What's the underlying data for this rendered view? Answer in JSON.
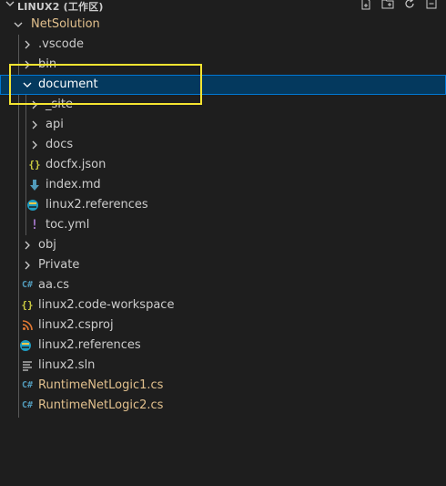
{
  "explorer": {
    "workspace_title": "LINUX2 (工作区)",
    "header_icons": [
      "new-file-icon",
      "new-folder-icon",
      "refresh-icon",
      "collapse-all-icon"
    ],
    "tree": [
      {
        "label": "NetSolution",
        "kind": "folder",
        "state": "expanded",
        "color": "#e2c08d",
        "icon": "chevron-down-icon"
      },
      {
        "label": ".vscode",
        "kind": "folder",
        "state": "collapsed",
        "color": "#cccccc",
        "icon": "chevron-right-icon"
      },
      {
        "label": "bin",
        "kind": "folder",
        "state": "collapsed",
        "color": "#cccccc",
        "icon": "chevron-right-icon"
      },
      {
        "label": "document",
        "kind": "folder",
        "state": "expanded",
        "selected": true,
        "color": "#ffffff",
        "icon": "chevron-down-icon"
      },
      {
        "label": "_site",
        "kind": "folder",
        "state": "collapsed",
        "color": "#cccccc",
        "icon": "chevron-right-icon"
      },
      {
        "label": "api",
        "kind": "folder",
        "state": "collapsed",
        "color": "#cccccc",
        "icon": "chevron-right-icon"
      },
      {
        "label": "docs",
        "kind": "folder",
        "state": "collapsed",
        "color": "#cccccc",
        "icon": "chevron-right-icon"
      },
      {
        "label": "docfx.json",
        "kind": "file",
        "color": "#cccccc",
        "icon": "json-file-icon"
      },
      {
        "label": "index.md",
        "kind": "file",
        "color": "#cccccc",
        "icon": "markdown-file-icon"
      },
      {
        "label": "linux2.references",
        "kind": "file",
        "color": "#cccccc",
        "icon": "references-file-icon"
      },
      {
        "label": "toc.yml",
        "kind": "file",
        "color": "#cccccc",
        "icon": "yaml-file-icon"
      },
      {
        "label": "obj",
        "kind": "folder",
        "state": "collapsed",
        "color": "#cccccc",
        "icon": "chevron-right-icon"
      },
      {
        "label": "Private",
        "kind": "folder",
        "state": "collapsed",
        "color": "#cccccc",
        "icon": "chevron-right-icon"
      },
      {
        "label": "aa.cs",
        "kind": "file",
        "color": "#cccccc",
        "icon": "csharp-file-icon"
      },
      {
        "label": "linux2.code-workspace",
        "kind": "file",
        "color": "#cccccc",
        "icon": "json-file-icon"
      },
      {
        "label": "linux2.csproj",
        "kind": "file",
        "color": "#cccccc",
        "icon": "rss-file-icon"
      },
      {
        "label": "linux2.references",
        "kind": "file",
        "color": "#cccccc",
        "icon": "references-file-icon"
      },
      {
        "label": "linux2.sln",
        "kind": "file",
        "color": "#cccccc",
        "icon": "solution-file-icon"
      },
      {
        "label": "RuntimeNetLogic1.cs",
        "kind": "file",
        "modified": true,
        "color": "#e2c08d",
        "icon": "csharp-file-icon"
      },
      {
        "label": "RuntimeNetLogic2.cs",
        "kind": "file",
        "modified": true,
        "color": "#e2c08d",
        "icon": "csharp-file-icon"
      }
    ]
  },
  "colors": {
    "background": "#1e1e1e",
    "selection": "#04395e",
    "selection_border": "#0078d4",
    "annotation_box": "#f5e430",
    "modified_text": "#e2c08d"
  }
}
